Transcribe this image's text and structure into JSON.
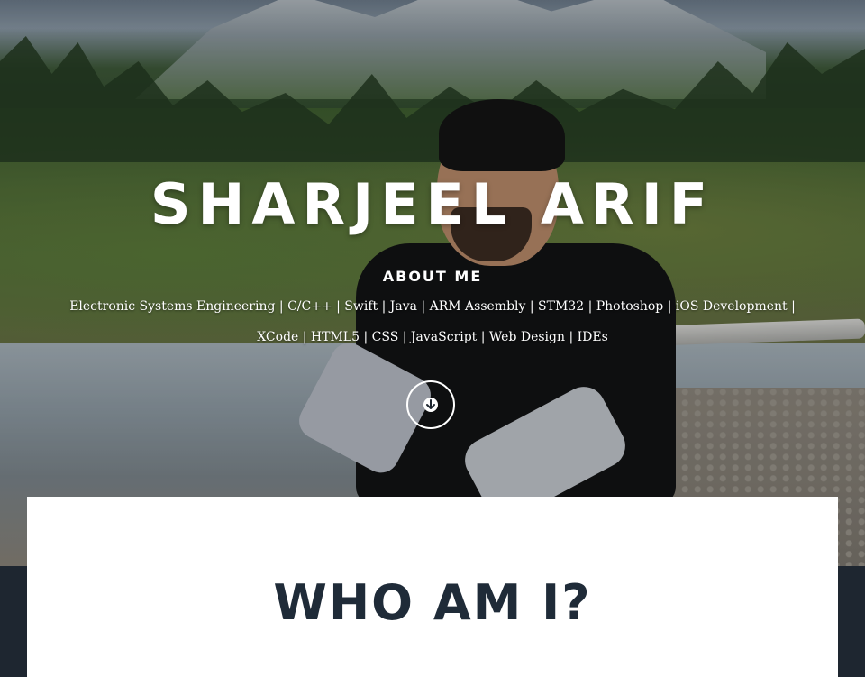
{
  "hero": {
    "name": "SHARJEEL ARIF",
    "about_heading": "ABOUT ME",
    "about_text": "Electronic Systems Engineering | C/C++ | Swift | Java | ARM Assembly | STM32 | Photoshop | iOS Development | XCode | HTML5 | CSS | JavaScript | Web Design | IDEs",
    "scroll_icon": "arrow-down-icon"
  },
  "section": {
    "title": "WHO AM I?"
  },
  "colors": {
    "dark_background": "#1e2630",
    "title_text": "#1f2b38",
    "card_background": "#ffffff"
  }
}
